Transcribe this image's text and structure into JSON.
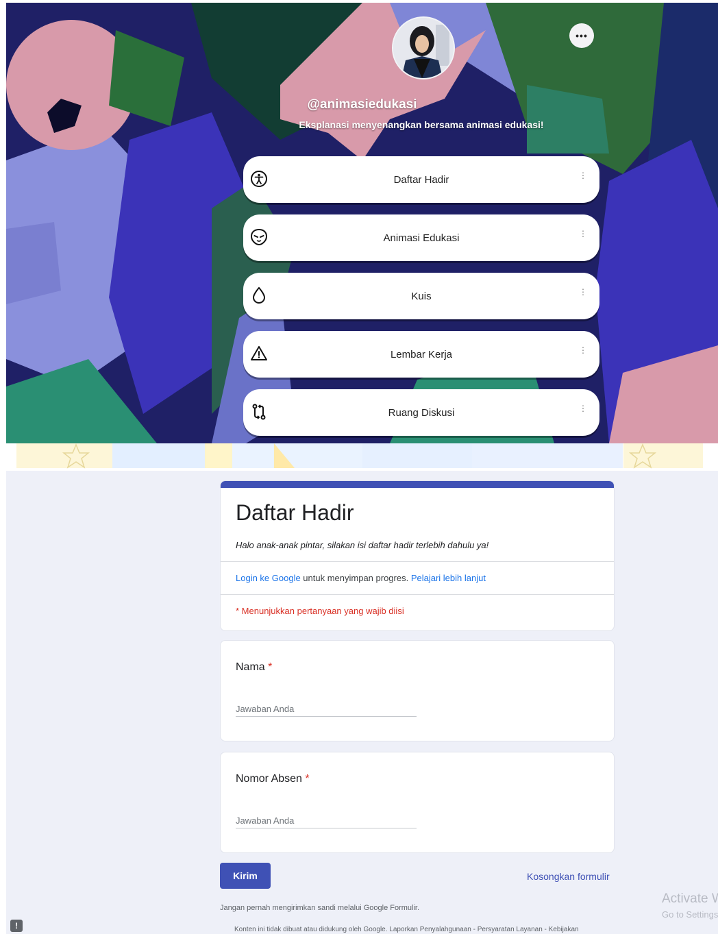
{
  "profile": {
    "handle": "@animasiedukasi",
    "bio": "Eksplanasi menyenangkan bersama animasi edukasi!",
    "more_label": "•••"
  },
  "links": [
    {
      "title": "Daftar Hadir",
      "icon": "accessibility-icon"
    },
    {
      "title": "Animasi Edukasi",
      "icon": "alien-face-icon"
    },
    {
      "title": "Kuis",
      "icon": "water-drop-icon"
    },
    {
      "title": "Lembar Kerja",
      "icon": "warning-triangle-icon"
    },
    {
      "title": "Ruang Diskusi",
      "icon": "pull-request-icon"
    }
  ],
  "link_more_label": "⋮",
  "form": {
    "title": "Daftar Hadir",
    "description": "Halo anak-anak pintar, silakan isi daftar hadir terlebih dahulu ya!",
    "login_link": "Login ke Google",
    "login_text": " untuk menyimpan progres. ",
    "learn_more": "Pelajari lebih lanjut",
    "required_note": "* Menunjukkan pertanyaan yang wajib diisi",
    "questions": [
      {
        "label": "Nama",
        "required_mark": "*",
        "placeholder": "Jawaban Anda"
      },
      {
        "label": "Nomor Absen",
        "required_mark": "*",
        "placeholder": "Jawaban Anda"
      }
    ],
    "submit_label": "Kirim",
    "clear_label": "Kosongkan formulir",
    "never_note": "Jangan pernah mengirimkan sandi melalui Google Formulir.",
    "footer_note": "Konten ini tidak dibuat atau didukung oleh Google. Laporkan Penyalahgunaan - Persyaratan Layanan - Kebijakan",
    "report_icon_label": "!"
  },
  "watermark": {
    "line1": "Activate W",
    "line2": "Go to Settings"
  },
  "colors": {
    "form_accent": "#3f51b5",
    "required": "#d93025",
    "link": "#1a73e8"
  }
}
